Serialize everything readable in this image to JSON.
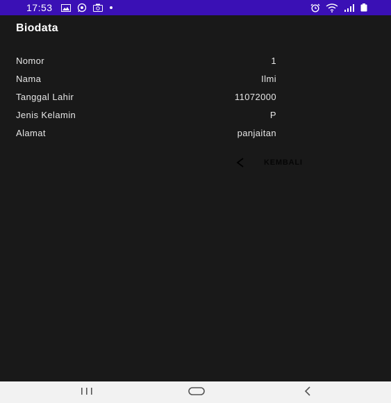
{
  "status_bar": {
    "time": "17:53",
    "left_icons": [
      "image-icon",
      "whatsapp-icon",
      "camera-icon",
      "dot-icon"
    ],
    "right_icons": [
      "alarm-icon",
      "wifi-icon",
      "signal-icon",
      "battery-icon"
    ],
    "background": "#3a10b5"
  },
  "page": {
    "title": "Biodata",
    "rows": [
      {
        "label": "Nomor",
        "value": "1"
      },
      {
        "label": "Nama",
        "value": "Ilmi"
      },
      {
        "label": "Tanggal Lahir",
        "value": "11072000"
      },
      {
        "label": "Jenis Kelamin",
        "value": "P"
      },
      {
        "label": "Alamat",
        "value": "panjaitan"
      }
    ],
    "back_button": {
      "label": "KEMBALI",
      "icon": "chevron-left-icon"
    }
  },
  "nav_bar": {
    "buttons": [
      "recent-apps-icon",
      "home-icon",
      "back-icon"
    ]
  }
}
